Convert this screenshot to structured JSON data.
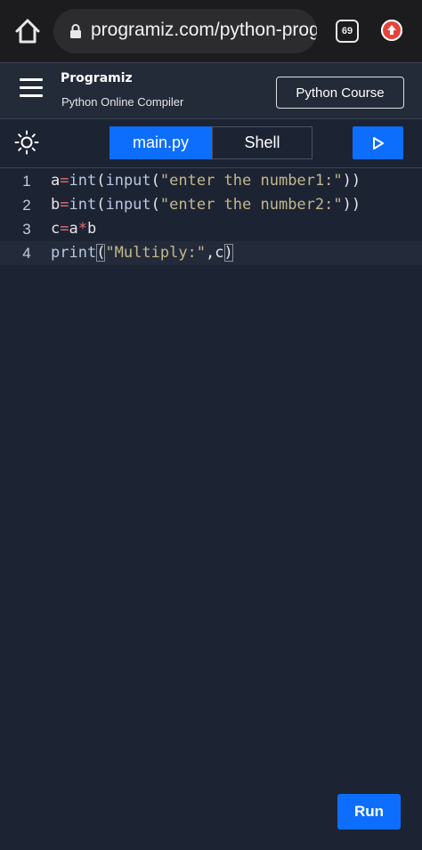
{
  "browser": {
    "url": "programiz.com/python-prograr",
    "tab_count": "69"
  },
  "header": {
    "brand": "Programiz",
    "subtitle": "Python Online Compiler",
    "course_button": "Python Course"
  },
  "toolbar": {
    "tabs": [
      {
        "label": "main.py",
        "active": true
      },
      {
        "label": "Shell",
        "active": false
      }
    ]
  },
  "editor": {
    "lines": [
      {
        "number": "1",
        "code": "a=int(input(\"enter the number1:\"))"
      },
      {
        "number": "2",
        "code": "b=int(input(\"enter the number2:\"))"
      },
      {
        "number": "3",
        "code": "c=a*b"
      },
      {
        "number": "4",
        "code": "print(\"Multiply:\",c)"
      }
    ],
    "active_line": 4
  },
  "run_button": "Run",
  "colors": {
    "accent": "#0d6efd",
    "background": "#1c2333",
    "operator": "#e06c75",
    "string": "#c3b88a"
  }
}
